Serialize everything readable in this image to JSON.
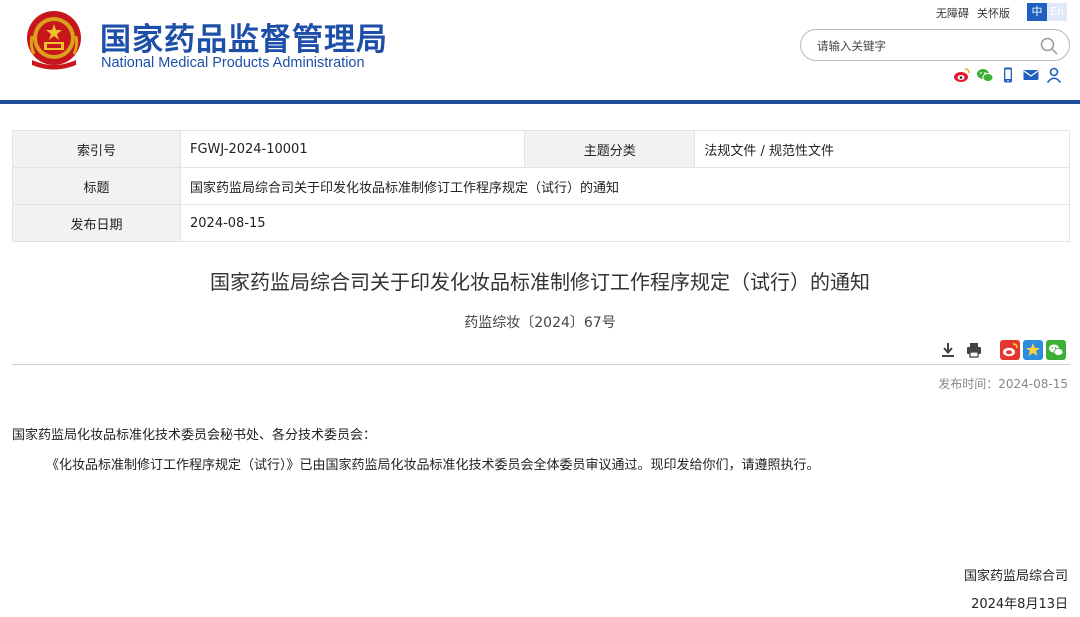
{
  "header": {
    "title_cn": "国家药品监督管理局",
    "title_en": "National Medical Products Administration",
    "links": [
      "无障碍",
      "关怀版"
    ],
    "lang_cn": "中",
    "lang_en": "En",
    "search_placeholder": "请输入关键字",
    "social_icons": [
      "weibo-icon",
      "wechat-icon",
      "mobile-icon",
      "mail-icon",
      "user-icon"
    ],
    "colors": {
      "brand_blue": "#1e4fa8",
      "divider_blue": "#1f4f9c"
    }
  },
  "info_table": {
    "index_label": "索引号",
    "index_value": "FGWJ-2024-10001",
    "category_label": "主题分类",
    "category_value": "法规文件 / 规范性文件",
    "title_label": "标题",
    "title_value": "国家药监局综合司关于印发化妆品标准制修订工作程序规定（试行）的通知",
    "date_label": "发布日期",
    "date_value": "2024-08-15"
  },
  "article": {
    "title": "国家药监局综合司关于印发化妆品标准制修订工作程序规定（试行）的通知",
    "doc_number": "药监综妆〔2024〕67号",
    "tool_icons": [
      "download-icon",
      "print-icon",
      "share-weibo-icon",
      "favorite-icon",
      "share-wechat-icon"
    ],
    "publish_time": "发布时间：2024-08-15",
    "salutation": "国家药监局化妆品标准化技术委员会秘书处、各分技术委员会：",
    "paragraph": "《化妆品标准制修订工作程序规定（试行）》已由国家药监局化妆品标准化技术委员会全体委员审议通过。现印发给你们，请遵照执行。",
    "signer": "国家药监局综合司",
    "sign_date": "2024年8月13日"
  }
}
